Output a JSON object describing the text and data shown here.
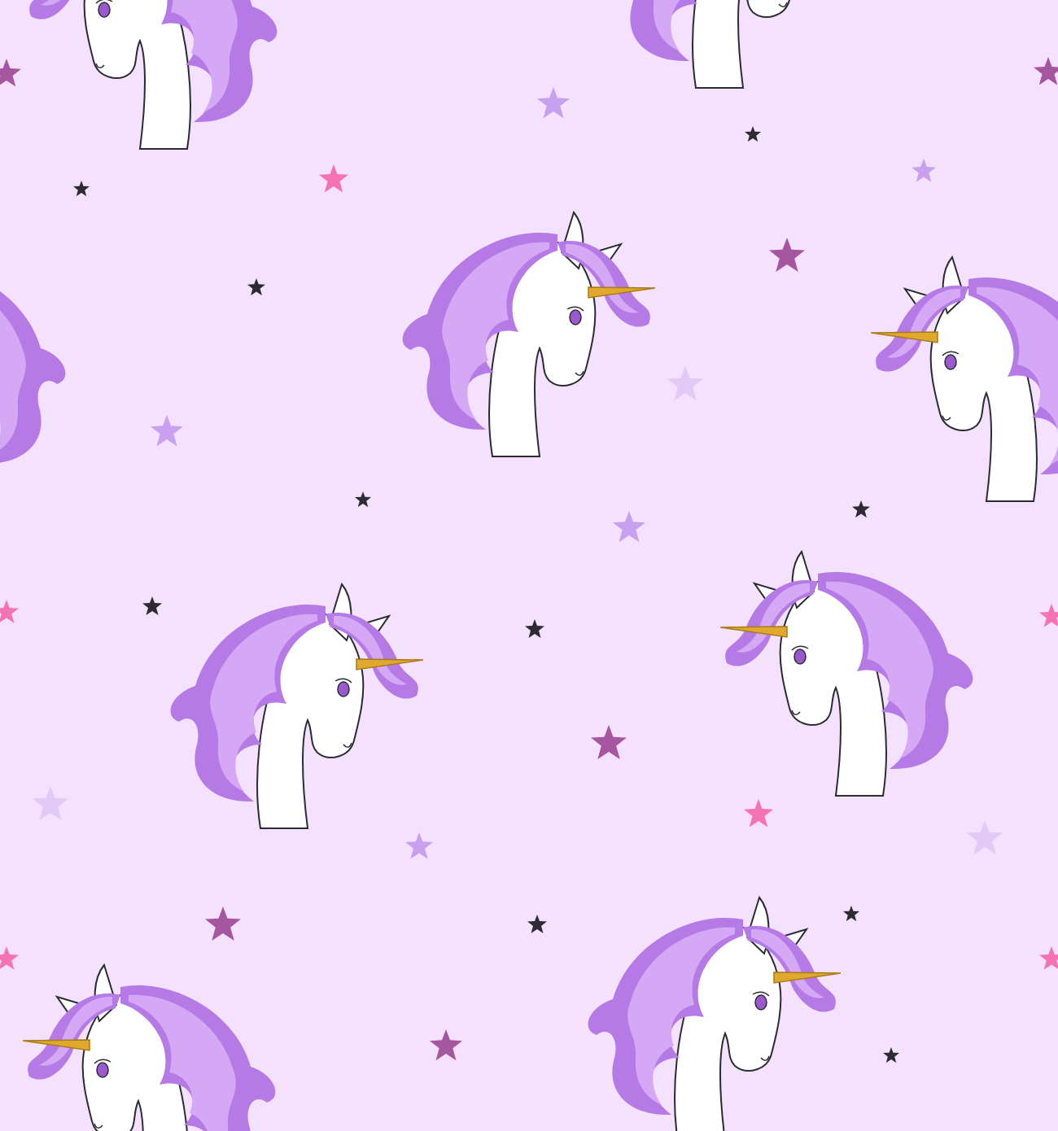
{
  "pattern": {
    "unicorns": [
      {
        "kind": "left"
      },
      {
        "kind": "right"
      },
      {
        "kind": "right"
      },
      {
        "kind": "left"
      },
      {
        "kind": "left"
      },
      {
        "kind": "right"
      },
      {
        "kind": "left"
      },
      {
        "kind": "left"
      },
      {
        "kind": "right"
      }
    ],
    "stars": [
      {
        "color": "#2d2a33"
      },
      {
        "color": "#2d2a33"
      },
      {
        "color": "#2d2a33"
      },
      {
        "color": "#2d2a33"
      },
      {
        "color": "#2d2a33"
      },
      {
        "color": "#2d2a33"
      },
      {
        "color": "#2d2a33"
      },
      {
        "color": "#2d2a33"
      },
      {
        "color": "#2d2a33"
      },
      {
        "color": "#2d2a33"
      },
      {
        "color": "#f573b5"
      },
      {
        "color": "#f573b5"
      },
      {
        "color": "#f573b5"
      },
      {
        "color": "#f573b5"
      },
      {
        "color": "#f573b5"
      },
      {
        "color": "#f573b5"
      },
      {
        "color": "#a6569f"
      },
      {
        "color": "#a6569f"
      },
      {
        "color": "#a6569f"
      },
      {
        "color": "#a6569f"
      },
      {
        "color": "#a6569f"
      },
      {
        "color": "#a6569f"
      },
      {
        "color": "#c9a0f0"
      },
      {
        "color": "#c9a0f0"
      },
      {
        "color": "#c9a0f0"
      },
      {
        "color": "#c9a0f0"
      },
      {
        "color": "#c9a0f0"
      },
      {
        "color": "#e3c9f5"
      },
      {
        "color": "#e3c9f5"
      },
      {
        "color": "#e3c9f5"
      }
    ]
  }
}
